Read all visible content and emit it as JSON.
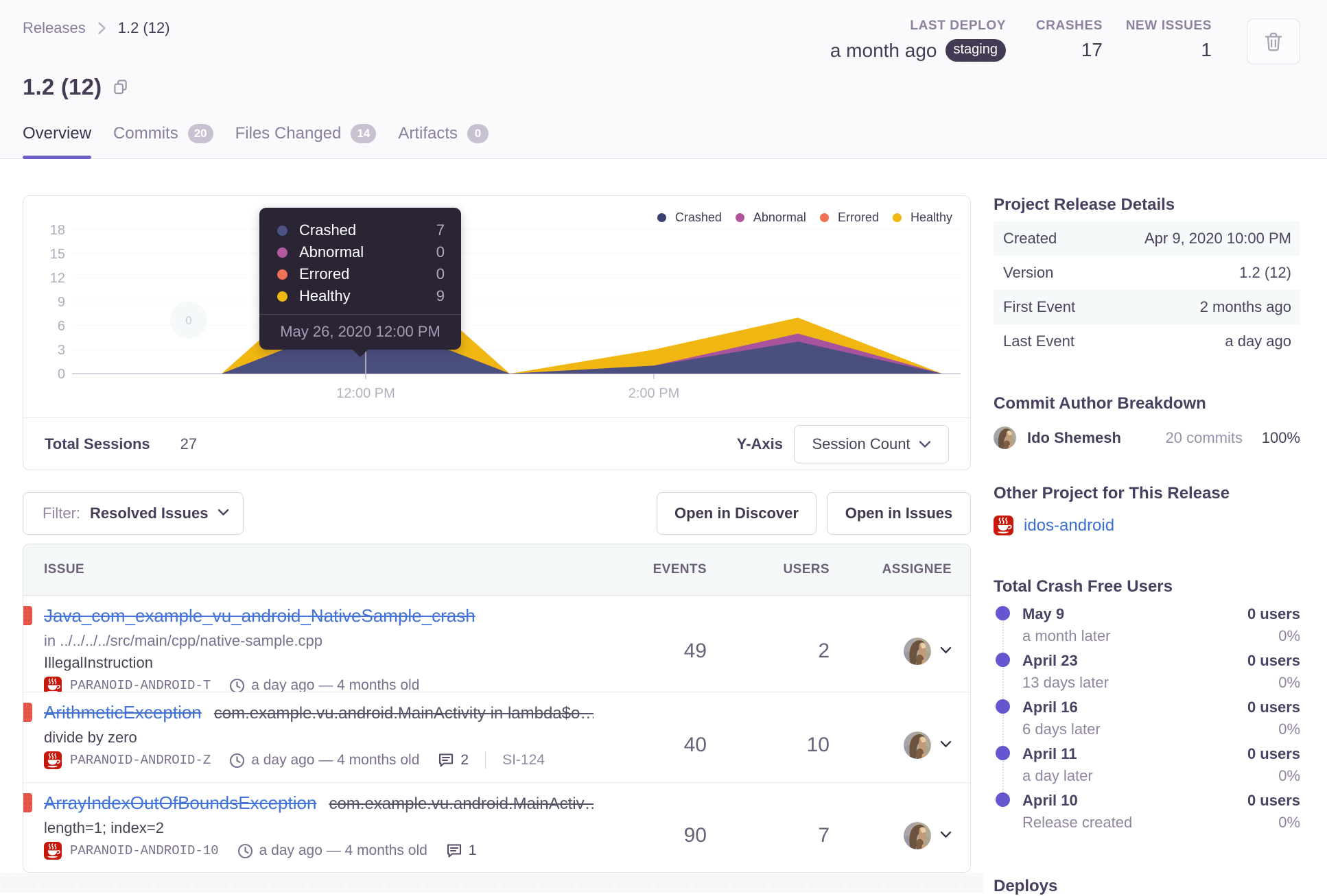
{
  "header": {
    "breadcrumb": {
      "root": "Releases",
      "current": "1.2 (12)"
    },
    "title": "1.2 (12)",
    "stats": [
      {
        "label": "LAST DEPLOY",
        "value": "a month ago",
        "tag": "staging"
      },
      {
        "label": "CRASHES",
        "value": "17",
        "tag": ""
      },
      {
        "label": "NEW ISSUES",
        "value": "1",
        "tag": ""
      }
    ]
  },
  "tabs": [
    {
      "label": "Overview",
      "badge": "",
      "active": true
    },
    {
      "label": "Commits",
      "badge": "20",
      "active": false
    },
    {
      "label": "Files Changed",
      "badge": "14",
      "active": false
    },
    {
      "label": "Artifacts",
      "badge": "0",
      "active": false
    }
  ],
  "chart_panel": {
    "legend": [
      {
        "name": "Crashed",
        "color": "#3b4070"
      },
      {
        "name": "Abnormal",
        "color": "#b0549c"
      },
      {
        "name": "Errored",
        "color": "#ef7156"
      },
      {
        "name": "Healthy",
        "color": "#f0b712"
      }
    ],
    "tooltip": {
      "rows": [
        {
          "name": "Crashed",
          "value": "7",
          "color": "#4a5382"
        },
        {
          "name": "Abnormal",
          "value": "0",
          "color": "#b35a9e"
        },
        {
          "name": "Errored",
          "value": "0",
          "color": "#ef7156"
        },
        {
          "name": "Healthy",
          "value": "9",
          "color": "#efb70f"
        }
      ],
      "date": "May 26, 2020 12:00 PM"
    },
    "zero_marker": "0",
    "footer": {
      "total_label": "Total Sessions",
      "total_value": "27",
      "yaxis_label": "Y-Axis",
      "yaxis_value": "Session Count"
    }
  },
  "chart_data": {
    "type": "area",
    "stacked": true,
    "x": [
      "11:00 AM",
      "12:00 PM",
      "1:00 PM",
      "2:00 PM",
      "3:00 PM",
      "4:00 PM"
    ],
    "series": [
      {
        "name": "Crashed",
        "values": [
          0,
          7,
          0,
          1,
          4,
          0
        ],
        "color": "#4b4f7e"
      },
      {
        "name": "Abnormal",
        "values": [
          0,
          0,
          0,
          0,
          1,
          0
        ],
        "color": "#a8549c"
      },
      {
        "name": "Errored",
        "values": [
          0,
          0,
          0,
          0,
          0,
          0
        ],
        "color": "#ef7156"
      },
      {
        "name": "Healthy",
        "values": [
          0,
          9,
          0,
          2,
          2,
          0
        ],
        "color": "#f0b712"
      }
    ],
    "ylim": [
      0,
      18
    ],
    "y_ticks": [
      18,
      15,
      12,
      9,
      6,
      3,
      0
    ],
    "x_tick_labels": [
      {
        "label": "12:00 PM",
        "index": 1
      },
      {
        "label": "2:00 PM",
        "index": 3
      }
    ],
    "legend_position": "top-right"
  },
  "filter_bar": {
    "label": "Filter:",
    "value": "Resolved Issues",
    "discover": "Open in Discover",
    "open_issues": "Open in Issues"
  },
  "issues": {
    "columns": [
      "ISSUE",
      "EVENTS",
      "USERS",
      "ASSIGNEE"
    ],
    "rows": [
      {
        "title": "Java_com_example_vu_android_NativeSample_crash",
        "culprit": "",
        "location": "in ../../../../src/main/cpp/native-sample.cpp",
        "message": "IllegalInstruction",
        "project_id": "PARANOID-ANDROID-T",
        "age": "a day ago — 4 months old",
        "comments": "",
        "short_id": "",
        "events": "49",
        "users": "2"
      },
      {
        "title": "ArithmeticException",
        "culprit": "com.example.vu.android.MainActivity in lambda$o…",
        "location": "",
        "message": "divide by zero",
        "project_id": "PARANOID-ANDROID-Z",
        "age": "a day ago — 4 months old",
        "comments": "2",
        "short_id": "SI-124",
        "events": "40",
        "users": "10"
      },
      {
        "title": "ArrayIndexOutOfBoundsException",
        "culprit": "com.example.vu.android.MainActiv…",
        "location": "",
        "message": "length=1; index=2",
        "project_id": "PARANOID-ANDROID-10",
        "age": "a day ago — 4 months old",
        "comments": "1",
        "short_id": "",
        "events": "90",
        "users": "7"
      }
    ]
  },
  "sidebar": {
    "release_details": {
      "heading": "Project Release Details",
      "rows": [
        {
          "label": "Created",
          "value": "Apr 9, 2020 10:00 PM"
        },
        {
          "label": "Version",
          "value": "1.2 (12)"
        },
        {
          "label": "First Event",
          "value": "2 months ago"
        },
        {
          "label": "Last Event",
          "value": "a day ago"
        }
      ]
    },
    "commit_authors": {
      "heading": "Commit Author Breakdown",
      "author": "Ido Shemesh",
      "commits": "20 commits",
      "percent": "100%"
    },
    "other_project": {
      "heading": "Other Project for This Release",
      "name": "idos-android"
    },
    "crash_free": {
      "heading": "Total Crash Free Users",
      "entries": [
        {
          "date": "May 9",
          "sub": "a month later",
          "users": "0 users",
          "pct": "0%"
        },
        {
          "date": "April 23",
          "sub": "13 days later",
          "users": "0 users",
          "pct": "0%"
        },
        {
          "date": "April 16",
          "sub": "6 days later",
          "users": "0 users",
          "pct": "0%"
        },
        {
          "date": "April 11",
          "sub": "a day later",
          "users": "0 users",
          "pct": "0%"
        },
        {
          "date": "April 10",
          "sub": "Release created",
          "users": "0 users",
          "pct": "0%"
        }
      ]
    },
    "deploys_heading": "Deploys"
  }
}
